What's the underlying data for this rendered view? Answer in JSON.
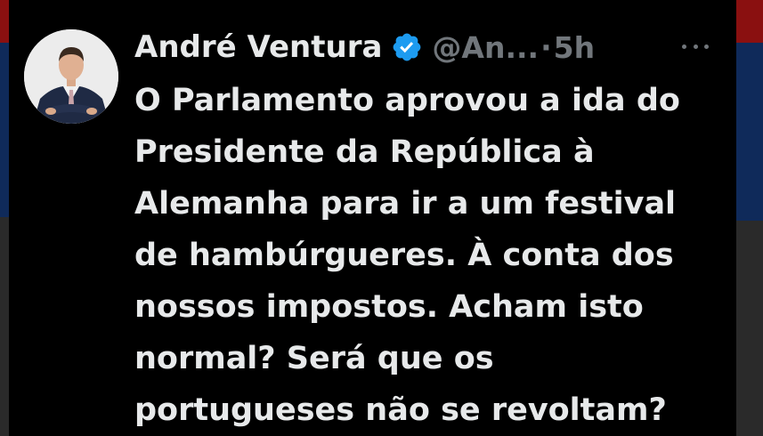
{
  "tweet": {
    "author_name": "André Ventura",
    "handle": "@An...",
    "separator": "·",
    "time": "5h",
    "verified": true,
    "verified_color": "#1d9bf0",
    "text_lines": [
      "O Parlamento aprovou a ida do",
      "Presidente da República à",
      "Alemanha para ir a um festival",
      "de hambúrgueres. À conta dos",
      "nossos impostos. Acham isto",
      "normal? Será que os",
      "portugueses não se revoltam?"
    ]
  },
  "icons": {
    "avatar": "profile-photo-avatar",
    "verified": "verified-badge-icon",
    "more": "more-options-icon"
  },
  "colors": {
    "background": "#000000",
    "primary_text": "#e7e9ea",
    "secondary_text": "#71767b"
  }
}
